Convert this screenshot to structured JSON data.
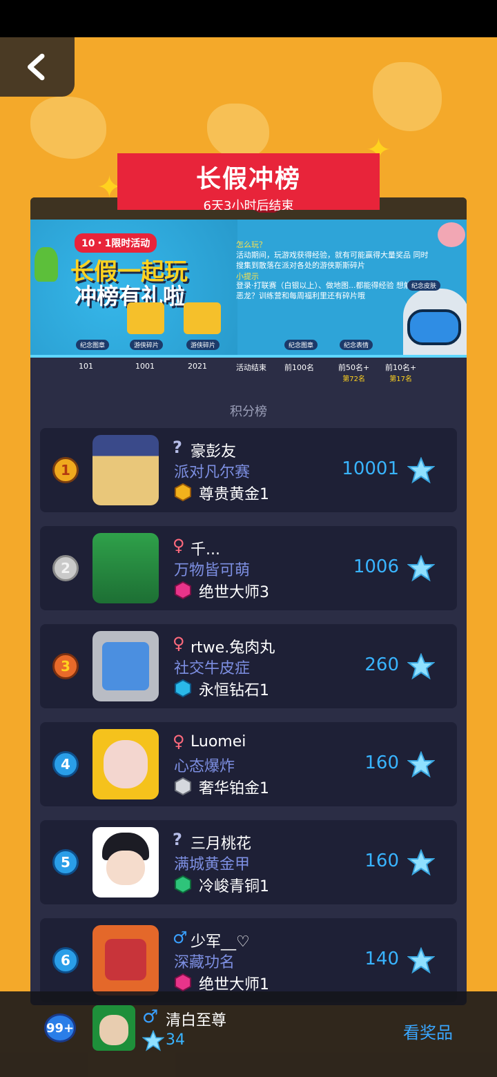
{
  "nav": {
    "back_label": "返回"
  },
  "event": {
    "title": "长假冲榜",
    "countdown": "6天3小时后结束"
  },
  "banner": {
    "tag": "10・1限时活动",
    "headline1": "长假一起玩",
    "headline2": "冲榜有礼啦",
    "how_title": "怎么玩？",
    "how_text": "活动期间，玩游戏获得经验，就有可能赢得大量奖品 同时搜集到散落在派对各处的游侠斯斯碎片",
    "tip_title": "小提示",
    "tip_text": "登录·打联赛（白银以上）、做地图...都能得经验 想解锁恶龙？训练营和每周福利里还有碎片哦",
    "rewards": [
      "纪念图章",
      "游侠碎片",
      "游侠碎片",
      "纪念图章",
      "纪念表情",
      "纪念皮肤"
    ],
    "milestones": [
      {
        "label": "101",
        "rank": ""
      },
      {
        "label": "1001",
        "rank": ""
      },
      {
        "label": "2021",
        "rank": ""
      },
      {
        "label": "活动结束",
        "rank": ""
      },
      {
        "label": "前100名",
        "rank": ""
      },
      {
        "label": "前50名+",
        "rank": "第72名"
      },
      {
        "label": "前10名+",
        "rank": "第17名"
      }
    ]
  },
  "leaderboard": {
    "title": "积分榜",
    "rows": [
      {
        "rank": "1",
        "gender": "?",
        "name": "豪彭友",
        "motto": "派对凡尔赛",
        "tier": "尊贵黄金1",
        "score": "10001"
      },
      {
        "rank": "2",
        "gender": "♀",
        "name": "千...",
        "motto": "万物皆可萌",
        "tier": "绝世大师3",
        "score": "1006"
      },
      {
        "rank": "3",
        "gender": "♀",
        "name": "rtwe.兔肉丸",
        "motto": "社交牛皮症",
        "tier": "永恒钻石1",
        "score": "260"
      },
      {
        "rank": "4",
        "gender": "♀",
        "name": "Luomei",
        "motto": "心态爆炸",
        "tier": "奢华铂金1",
        "score": "160"
      },
      {
        "rank": "5",
        "gender": "?",
        "name": "三月桃花",
        "motto": "满城黄金甲",
        "tier": "冷峻青铜1",
        "score": "160"
      },
      {
        "rank": "6",
        "gender": "♂",
        "name": "少军__♡",
        "motto": "深藏功名",
        "tier": "绝世大师1",
        "score": "140"
      }
    ]
  },
  "me": {
    "rank": "99+",
    "gender": "♂",
    "name": "清白至尊",
    "score": "34",
    "view_prizes": "看奖品"
  },
  "colors": {
    "background": "#f4a92a",
    "panel": "#2b2d45",
    "row": "#1e2036",
    "accent_red": "#e8243a",
    "score_blue": "#39b4ff"
  }
}
